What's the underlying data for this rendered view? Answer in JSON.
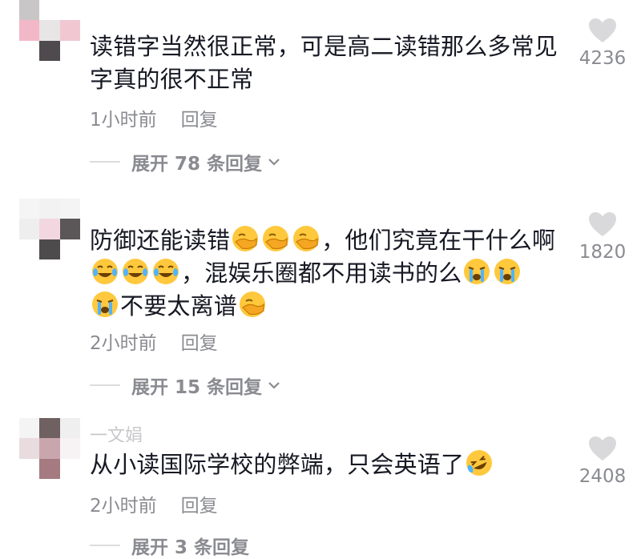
{
  "comments": [
    {
      "username": "",
      "text_parts": [
        "读错字当然很正常，可是高二读错那么多常见字真的很不正常"
      ],
      "time": "1小时前",
      "reply_label": "回复",
      "expand_label": "展开 78 条回复",
      "likes": "4236"
    },
    {
      "username": "",
      "text_parts": [
        "防御还能读错",
        "，他们究竟在干什么啊",
        "，混娱乐圈都不用读书的么",
        "不要太离谱"
      ],
      "time": "2小时前",
      "reply_label": "回复",
      "expand_label": "展开 15 条回复",
      "likes": "1820"
    },
    {
      "username": "一文娟",
      "text_parts": [
        "从小读国际学校的弊端，只会英语了"
      ],
      "time": "2小时前",
      "reply_label": "回复",
      "expand_label": "展开 3 条回复",
      "likes": "2408"
    }
  ],
  "emoji_names": {
    "facepalm": "facepalm-emoji",
    "tears_of_joy": "tears-of-joy-emoji",
    "crying": "loudly-crying-emoji",
    "rofl": "rofl-emoji"
  },
  "colors": {
    "text": "#161823",
    "meta": "#8a8b91",
    "heart": "#d9d9dc",
    "emoji_yellow": "#ffc83d"
  }
}
